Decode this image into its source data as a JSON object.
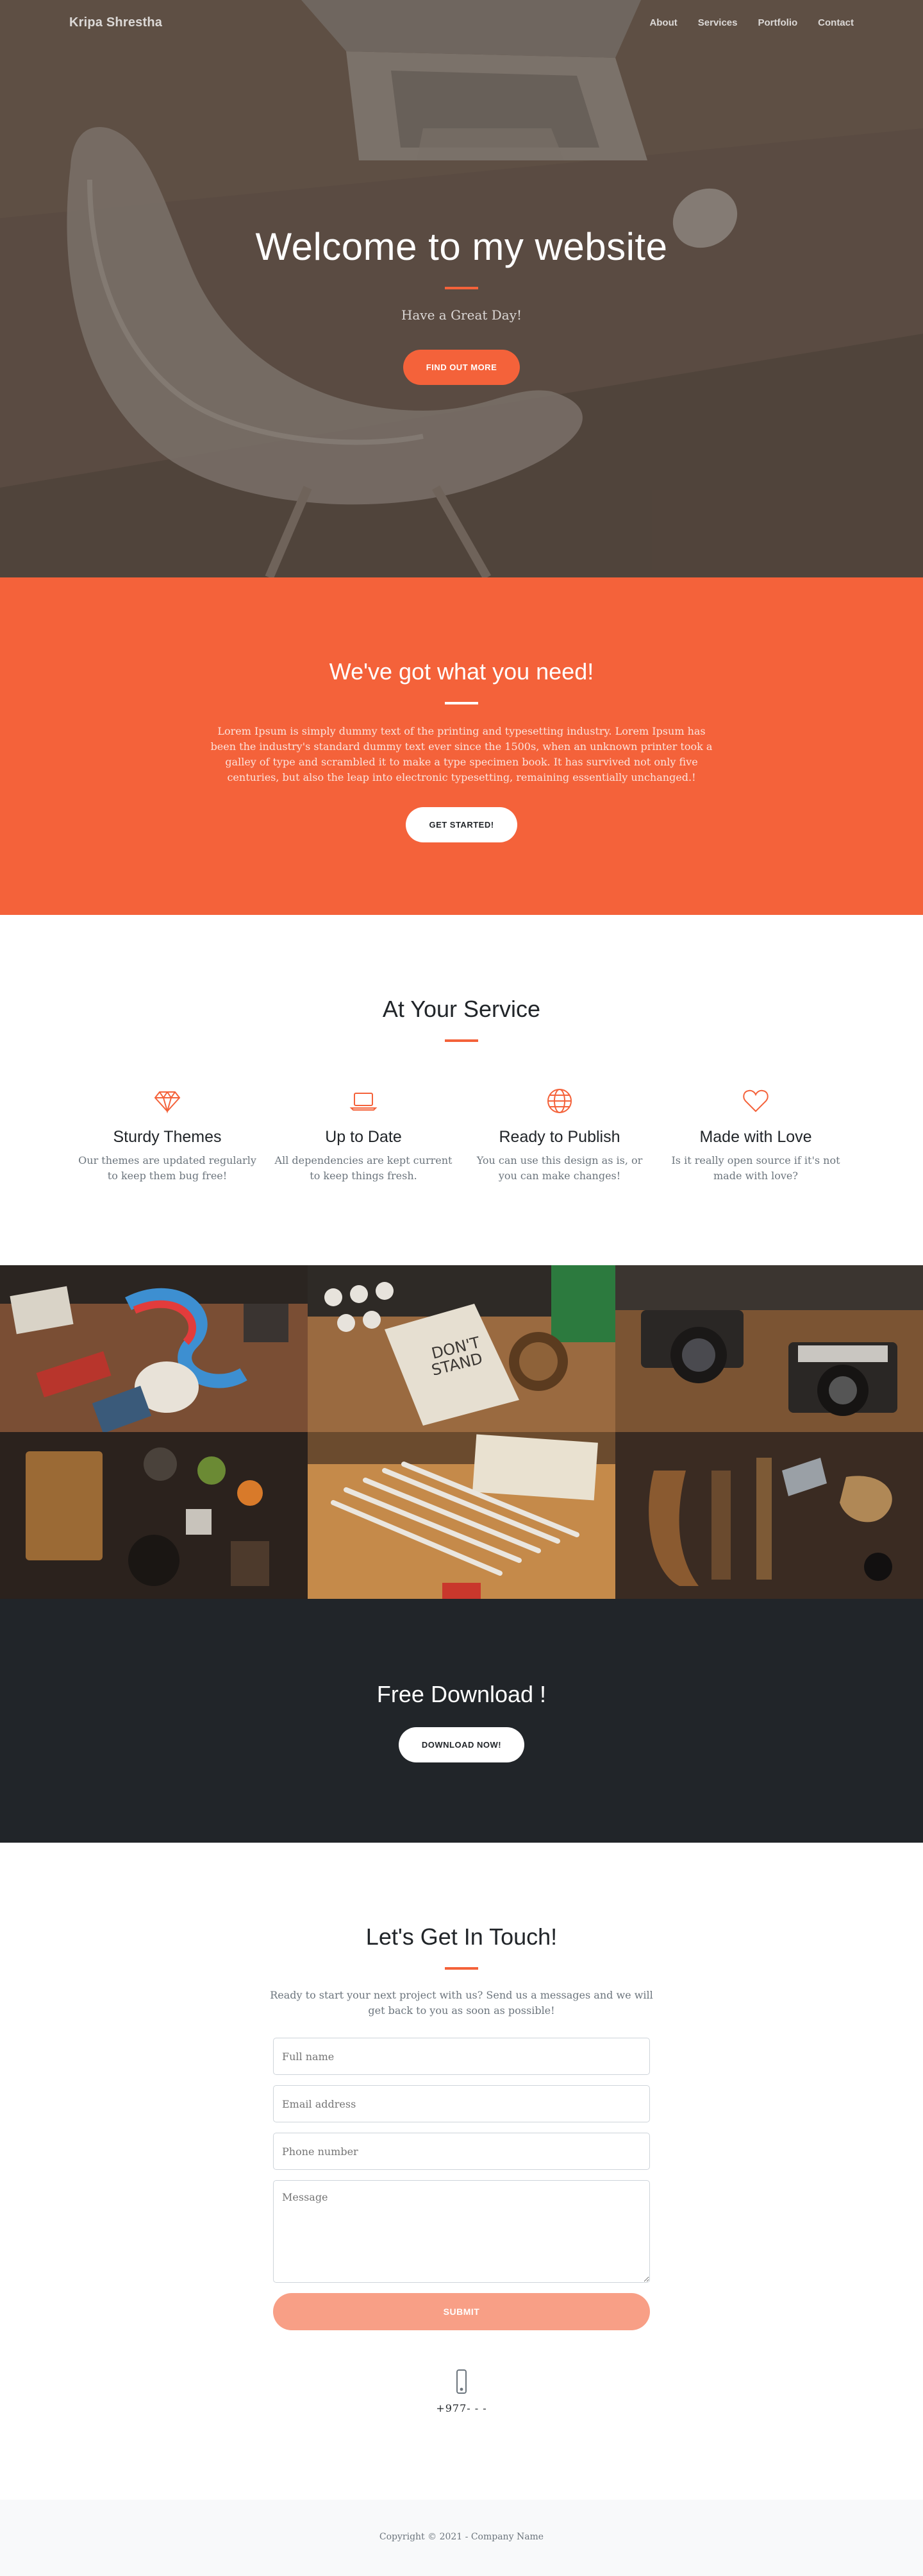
{
  "nav": {
    "brand": "Kripa Shrestha",
    "links": [
      "About",
      "Services",
      "Portfolio",
      "Contact"
    ]
  },
  "hero": {
    "title": "Welcome to my website",
    "subtitle": "Have a Great Day!",
    "button": "FIND OUT MORE"
  },
  "about": {
    "title": "We've got what you need!",
    "text": "Lorem Ipsum is simply dummy text of the printing and typesetting industry. Lorem Ipsum has been the industry's standard dummy text ever since the 1500s, when an unknown printer took a galley of type and scrambled it to make a type specimen book. It has survived not only five centuries, but also the leap into electronic typesetting, remaining essentially unchanged.!",
    "button": "GET STARTED!"
  },
  "services": {
    "title": "At Your Service",
    "items": [
      {
        "icon": "gem-icon",
        "title": "Sturdy Themes",
        "text": "Our themes are updated regularly to keep them bug free!"
      },
      {
        "icon": "laptop-icon",
        "title": "Up to Date",
        "text": "All dependencies are kept current to keep things fresh."
      },
      {
        "icon": "globe-icon",
        "title": "Ready to Publish",
        "text": "You can use this design as is, or you can make changes!"
      },
      {
        "icon": "heart-icon",
        "title": "Made with Love",
        "text": "Is it really open source if it's not made with love?"
      }
    ]
  },
  "download": {
    "title": "Free Download !",
    "button": "DOWNLOAD NOW!"
  },
  "contact": {
    "title": "Let's Get In Touch!",
    "lead": "Ready to start your next project with us? Send us a messages and we will get back to you as soon as possible!",
    "fields": {
      "name": "Full name",
      "email": "Email address",
      "phone": "Phone number",
      "message": "Message"
    },
    "submit": "SUBMIT",
    "phone_icon": "phone-icon",
    "phone": "+977- - -"
  },
  "footer": {
    "copyright": "Copyright © 2021 - Company Name"
  },
  "colors": {
    "primary": "#f4623a",
    "dark": "#212529",
    "muted": "#6c757d"
  }
}
